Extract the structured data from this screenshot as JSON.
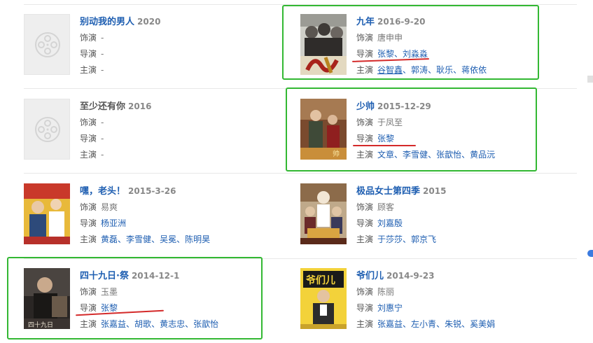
{
  "labels": {
    "role": "饰演",
    "director": "导演",
    "cast": "主演"
  },
  "movies": [
    {
      "title": "别动我的男人",
      "year": "2020",
      "poster": "placeholder",
      "role": "-",
      "director": [
        "-"
      ],
      "cast": [
        "-"
      ]
    },
    {
      "title": "九年",
      "year": "2016-9-20",
      "poster": "image",
      "role": "唐申申",
      "director": [
        "张黎",
        "刘淼淼"
      ],
      "cast": [
        "谷智鑫",
        "郭涛",
        "耿乐",
        "蒋依依"
      ]
    },
    {
      "title": "至少还有你",
      "year": "2016",
      "poster": "placeholder",
      "role": "-",
      "director": [
        "-"
      ],
      "cast": [
        "-"
      ]
    },
    {
      "title": "少帅",
      "year": "2015-12-29",
      "poster": "image",
      "role": "于凤至",
      "director": [
        "张黎"
      ],
      "cast": [
        "文章",
        "李雪健",
        "张歆怡",
        "黄品沅"
      ]
    },
    {
      "title": "嘿，老头！",
      "year": "2015-3-26",
      "poster": "image",
      "role": "易爽",
      "director": [
        "杨亚洲"
      ],
      "cast": [
        "黄磊",
        "李雪健",
        "吴冕",
        "陈明昊"
      ]
    },
    {
      "title": "极品女士第四季",
      "year": "2015",
      "poster": "image",
      "role": "顾客",
      "director": [
        "刘嘉殷"
      ],
      "cast": [
        "于莎莎",
        "郭京飞"
      ]
    },
    {
      "title": "四十九日·祭",
      "year": "2014-12-1",
      "poster": "image",
      "role": "玉墨",
      "director": [
        "张黎"
      ],
      "cast": [
        "张嘉益",
        "胡歌",
        "黄志忠",
        "张歆怡"
      ]
    },
    {
      "title": "爷们儿",
      "year": "2014-9-23",
      "poster": "image",
      "role": "陈丽",
      "director": [
        "刘惠宁"
      ],
      "cast": [
        "张嘉益",
        "左小青",
        "朱锐",
        "奚美娟"
      ]
    }
  ],
  "colors": {
    "link": "#1e5eb1",
    "highlight": "#33b833",
    "underline": "#d42a2a"
  }
}
